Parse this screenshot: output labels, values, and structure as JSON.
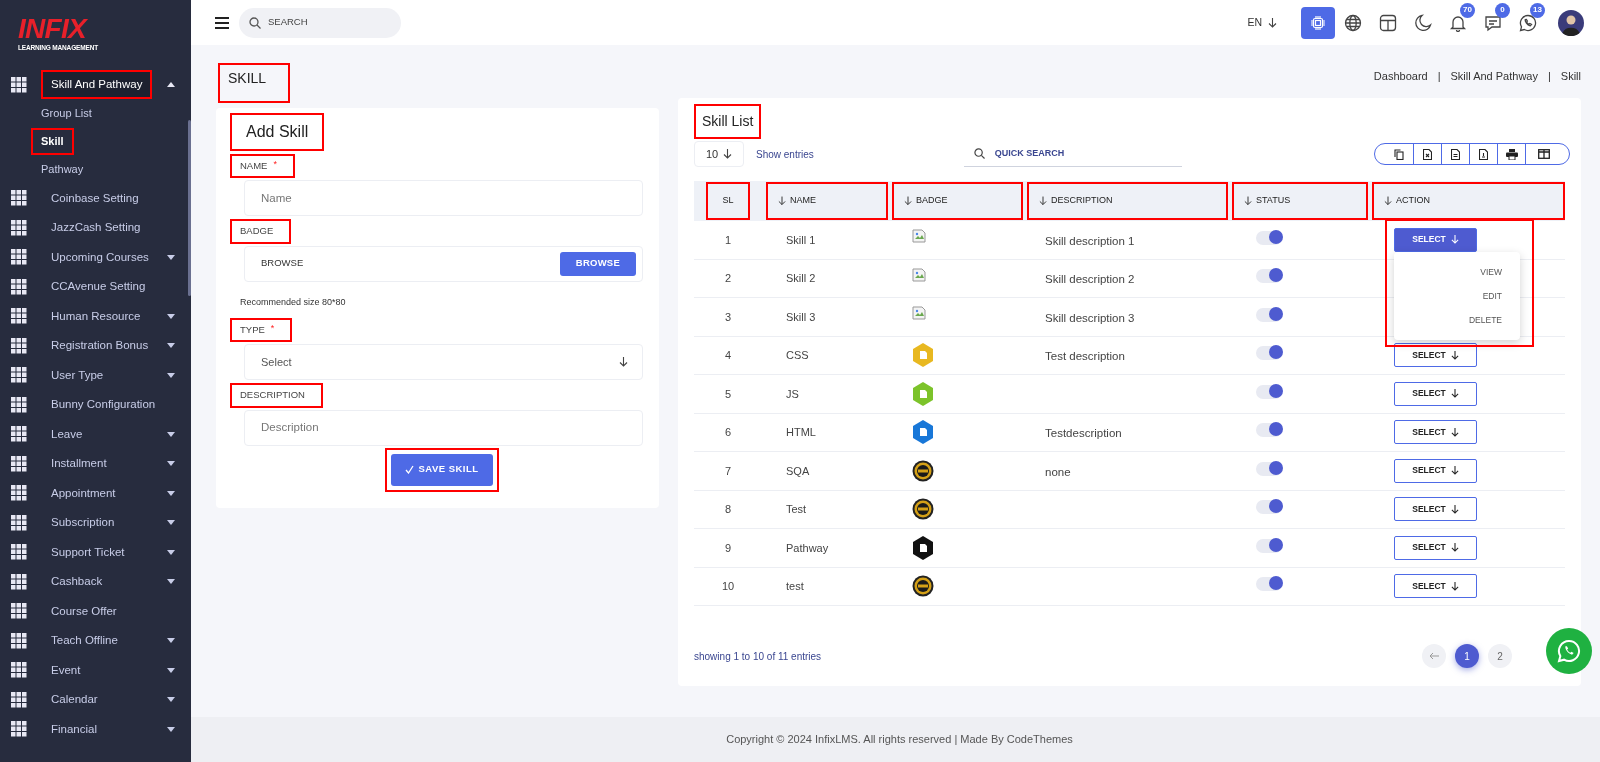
{
  "sidebar": {
    "logo": {
      "wordmark": "INFIX",
      "tagline": "LEARNING MANAGEMENT"
    },
    "items": [
      {
        "label": "Skill And Pathway",
        "expanded": true,
        "highlighted": true,
        "children": [
          {
            "label": "Group List",
            "selected": false,
            "highlighted": false
          },
          {
            "label": "Skill",
            "selected": true,
            "highlighted": true
          },
          {
            "label": "Pathway",
            "selected": false,
            "highlighted": false
          }
        ]
      },
      {
        "label": "Coinbase Setting",
        "highlighted": false
      },
      {
        "label": "JazzCash Setting",
        "highlighted": false
      },
      {
        "label": "Upcoming Courses",
        "expanded": false,
        "highlighted": false
      },
      {
        "label": "CCAvenue Setting",
        "highlighted": false
      },
      {
        "label": "Human Resource",
        "expanded": false,
        "highlighted": false
      },
      {
        "label": "Registration Bonus",
        "expanded": false,
        "highlighted": false
      },
      {
        "label": "User Type",
        "expanded": false,
        "highlighted": false
      },
      {
        "label": "Bunny Configuration",
        "highlighted": false
      },
      {
        "label": "Leave",
        "expanded": false,
        "highlighted": false
      },
      {
        "label": "Installment",
        "expanded": false,
        "highlighted": false
      },
      {
        "label": "Appointment",
        "expanded": false,
        "highlighted": false
      },
      {
        "label": "Subscription",
        "expanded": false,
        "highlighted": false
      },
      {
        "label": "Support Ticket",
        "expanded": false,
        "highlighted": false
      },
      {
        "label": "Cashback",
        "expanded": false,
        "highlighted": false
      },
      {
        "label": "Course Offer",
        "highlighted": false
      },
      {
        "label": "Teach Offline",
        "expanded": false,
        "highlighted": false
      },
      {
        "label": "Event",
        "expanded": false,
        "highlighted": false
      },
      {
        "label": "Calendar",
        "expanded": false,
        "highlighted": false
      },
      {
        "label": "Financial",
        "expanded": false,
        "highlighted": false
      }
    ]
  },
  "topbar": {
    "search": {
      "placeholder": "SEARCH"
    },
    "language": "EN",
    "icons": [
      {
        "kind": "chip",
        "active": true
      },
      {
        "kind": "globe",
        "active": false
      },
      {
        "kind": "layout",
        "active": false
      },
      {
        "kind": "moon",
        "active": false
      },
      {
        "kind": "bell",
        "active": false,
        "count": "70"
      },
      {
        "kind": "chat",
        "active": false,
        "count": "0"
      },
      {
        "kind": "whatsapp",
        "active": false,
        "count": "13"
      }
    ]
  },
  "page": {
    "title": "SKILL",
    "highlighted": true,
    "breadcrumb": [
      "Dashboard",
      "Skill And Pathway",
      "Skill"
    ],
    "separator": "|"
  },
  "form": {
    "title": "Add Skill",
    "highlighted": true,
    "fields": [
      {
        "kind": "text",
        "label": "NAME",
        "required_mark": "*",
        "highlighted": true,
        "placeholder": "Name"
      },
      {
        "kind": "file",
        "label": "BADGE",
        "highlighted": true,
        "value": "BROWSE",
        "button": "BROWSE",
        "hint": "Recommended size 80*80"
      },
      {
        "kind": "select",
        "label": "TYPE",
        "required_mark": "*",
        "highlighted": true,
        "placeholder": "Select"
      },
      {
        "kind": "text",
        "label": "DESCRIPTION",
        "highlighted": true,
        "placeholder": "Description"
      }
    ],
    "submit": {
      "label": "SAVE SKILL",
      "highlighted": true
    }
  },
  "table": {
    "title": "Skill List",
    "highlighted": true,
    "page_size": "10",
    "page_size_label": "Show entries",
    "search_placeholder": "QUICK SEARCH",
    "export_buttons": [
      {
        "kind": "copy"
      },
      {
        "kind": "excel"
      },
      {
        "kind": "csv"
      },
      {
        "kind": "pdf"
      },
      {
        "kind": "print"
      },
      {
        "kind": "columns"
      }
    ],
    "columns": [
      {
        "label": "SL",
        "sortable": false,
        "highlighted": true
      },
      {
        "label": "NAME",
        "sortable": true,
        "highlighted": true
      },
      {
        "label": "BADGE",
        "sortable": true,
        "highlighted": true
      },
      {
        "label": "DESCRIPTION",
        "sortable": true,
        "highlighted": true
      },
      {
        "label": "STATUS",
        "sortable": true,
        "highlighted": true
      },
      {
        "label": "ACTION",
        "sortable": true,
        "highlighted": true
      }
    ],
    "rows": [
      {
        "sl": "1",
        "name": "Skill 1",
        "badge": {
          "kind": "broken"
        },
        "description": "Skill description 1",
        "on": true,
        "action": "SELECT",
        "open": true,
        "menu": [
          "VIEW",
          "EDIT",
          "DELETE"
        ]
      },
      {
        "sl": "2",
        "name": "Skill 2",
        "badge": {
          "kind": "broken"
        },
        "description": "Skill description 2",
        "on": true
      },
      {
        "sl": "3",
        "name": "Skill 3",
        "badge": {
          "kind": "broken"
        },
        "description": "Skill description 3",
        "on": true
      },
      {
        "sl": "4",
        "name": "CSS",
        "badge": {
          "kind": "hexagon",
          "color": "#e8b820"
        },
        "description": "Test description",
        "on": true,
        "action": "SELECT",
        "open": false
      },
      {
        "sl": "5",
        "name": "JS",
        "badge": {
          "kind": "hexagon",
          "color": "#7cc32a"
        },
        "on": true,
        "action": "SELECT",
        "open": false
      },
      {
        "sl": "6",
        "name": "HTML",
        "badge": {
          "kind": "hexagon",
          "color": "#1877d8"
        },
        "description": "Testdescription",
        "on": true,
        "action": "SELECT",
        "open": false
      },
      {
        "sl": "7",
        "name": "SQA",
        "badge": {
          "kind": "medal"
        },
        "description": "none",
        "on": true,
        "action": "SELECT",
        "open": false
      },
      {
        "sl": "8",
        "name": "Test",
        "badge": {
          "kind": "medal"
        },
        "on": true,
        "action": "SELECT",
        "open": false
      },
      {
        "sl": "9",
        "name": "Pathway",
        "badge": {
          "kind": "hexagon",
          "color": "#111111"
        },
        "on": true,
        "action": "SELECT",
        "open": false
      },
      {
        "sl": "10",
        "name": "test",
        "badge": {
          "kind": "medal"
        },
        "on": true,
        "action": "SELECT",
        "open": false
      }
    ],
    "action_menu_highlighted": true,
    "summary": "showing 1 to 10 of 11 entries",
    "pages": [
      {
        "label": "1",
        "selected": true
      },
      {
        "label": "2",
        "selected": false
      }
    ]
  },
  "footer": {
    "copyright": "Copyright © 2024 InfixLMS. All rights reserved | Made By CodeThemes"
  }
}
